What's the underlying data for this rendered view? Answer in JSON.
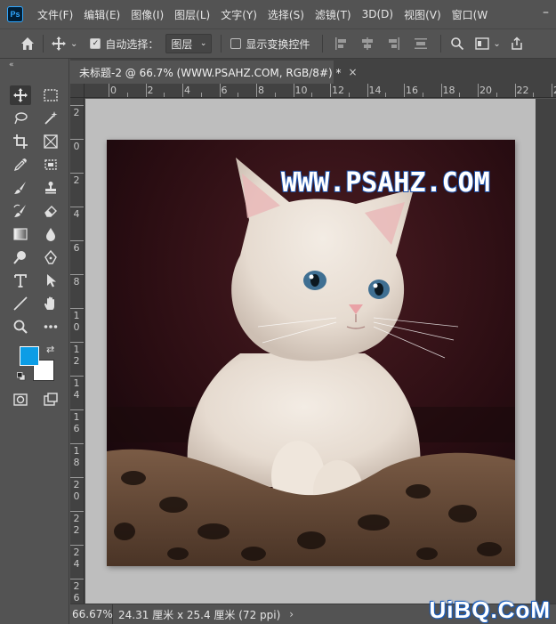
{
  "app": {
    "logo_text": "Ps"
  },
  "menu": [
    "文件(F)",
    "编辑(E)",
    "图像(I)",
    "图层(L)",
    "文字(Y)",
    "选择(S)",
    "滤镜(T)",
    "3D(D)",
    "视图(V)",
    "窗口(W"
  ],
  "window_controls": {
    "minimize": "–"
  },
  "options": {
    "auto_select_label": "自动选择：",
    "auto_select_checked": true,
    "layer_select_value": "图层",
    "show_transform_label": "显示变换控件",
    "show_transform_checked": false
  },
  "document_tab": {
    "title": "未标题-2 @ 66.7% (WWW.PSAHZ.COM, RGB/8#) *",
    "close": "×"
  },
  "ruler_top_labels": [
    "0",
    "2",
    "4",
    "6",
    "8",
    "10",
    "12",
    "14",
    "16",
    "18",
    "20",
    "22",
    "24"
  ],
  "ruler_left_labels": [
    "2",
    "0",
    "2",
    "4",
    "6",
    "8",
    "1\n0",
    "1\n2",
    "1\n4",
    "1\n6",
    "1\n8",
    "2\n0",
    "2\n2",
    "2\n4",
    "2\n6"
  ],
  "canvas": {
    "text_layer": "WWW.PSAHZ.COM"
  },
  "colors": {
    "foreground": "#0c9de6",
    "background": "#ffffff",
    "text_fill": "#ffffff",
    "text_stroke": "#1a4fa8"
  },
  "status": {
    "zoom": "66.67%",
    "doc_info": "24.31 厘米 x 25.4 厘米 (72 ppi)",
    "arrow": "›"
  },
  "watermark": "UiBQ.CoM",
  "tools": [
    "move-icon",
    "marquee-icon",
    "lasso-icon",
    "magic-wand-icon",
    "crop-icon",
    "frame-icon",
    "eyedropper-icon",
    "patch-icon",
    "brush-icon",
    "stamp-icon",
    "history-brush-icon",
    "eraser-icon",
    "gradient-icon",
    "blur-icon",
    "dodge-icon",
    "pen-icon",
    "type-icon",
    "path-select-icon",
    "line-icon",
    "hand-icon",
    "zoom-icon",
    "more-icon",
    "quick-mask-icon",
    "screen-mode-icon"
  ]
}
